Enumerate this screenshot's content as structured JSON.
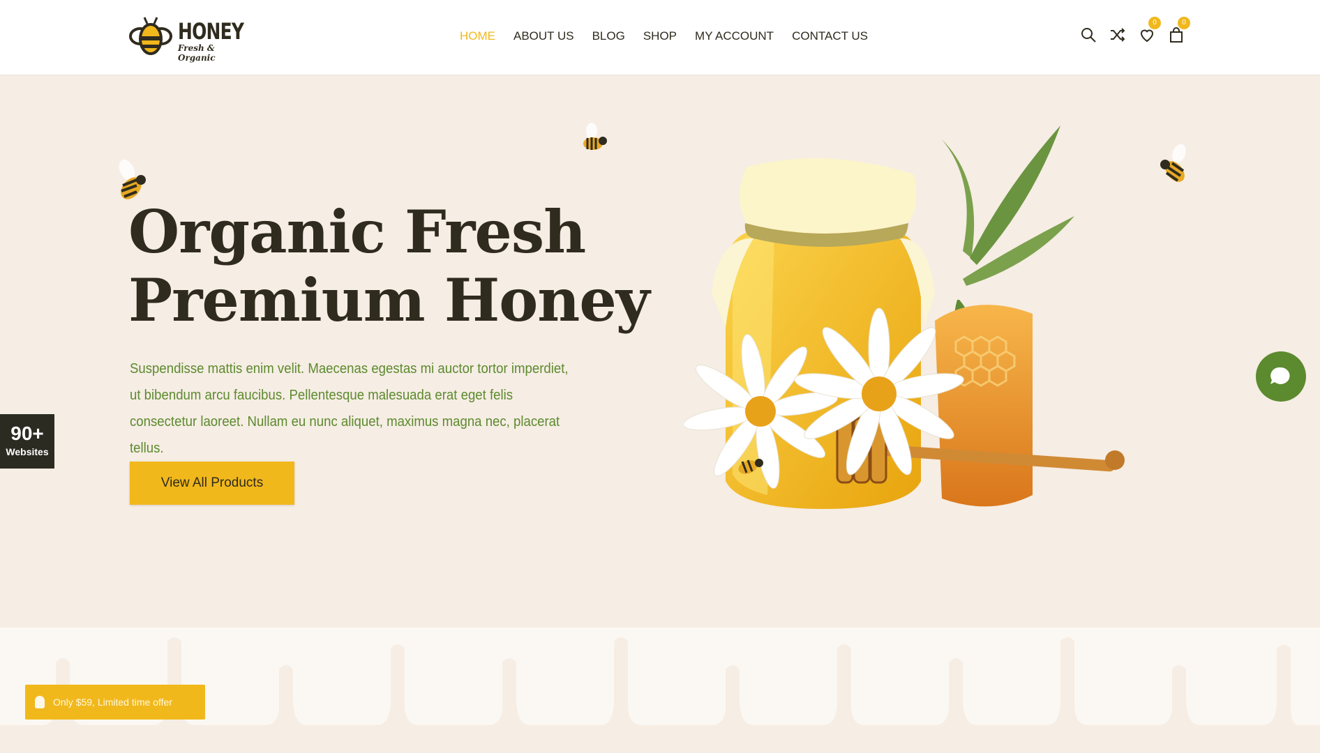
{
  "logo": {
    "title": "HONEY",
    "subtitle": "Fresh & Organic"
  },
  "nav": [
    {
      "label": "HOME",
      "active": true
    },
    {
      "label": "ABOUT US"
    },
    {
      "label": "BLOG"
    },
    {
      "label": "SHOP"
    },
    {
      "label": "MY ACCOUNT"
    },
    {
      "label": "CONTACT US"
    }
  ],
  "header_icons": {
    "wishlist_count": "0",
    "cart_count": "0"
  },
  "hero": {
    "title_line1": "Organic Fresh",
    "title_line2": "Premium Honey",
    "text": "Suspendisse mattis enim velit. Maecenas egestas mi auctor tortor imperdiet, ut bibendum arcu faucibus. Pellentesque malesuada erat eget felis consectetur laoreet. Nullam eu nunc aliquet, maximus magna nec, placerat tellus.",
    "cta_label": "View All Products"
  },
  "side_badge": {
    "number": "90+",
    "label": "Websites"
  },
  "offer": {
    "text": "Only $59, Limited time offer"
  },
  "colors": {
    "accent": "#f1b81c",
    "dark": "#2f2b1e",
    "green": "#5c8a2e",
    "background": "#f6ede4"
  }
}
